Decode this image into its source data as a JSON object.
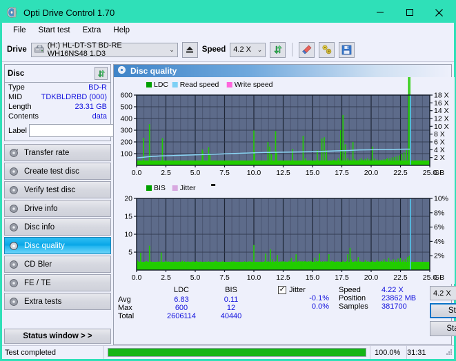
{
  "window": {
    "title": "Opti Drive Control 1.70",
    "app_icon": "disc-icon",
    "minimize": "–",
    "maximize": "▢",
    "close": "✕",
    "titlebar_color": "#2fe0b8"
  },
  "menubar": {
    "items": [
      {
        "label": "File"
      },
      {
        "label": "Start test"
      },
      {
        "label": "Extra"
      },
      {
        "label": "Help"
      }
    ]
  },
  "toolbar": {
    "drive_label": "Drive",
    "drive_value": "(H:)  HL-DT-ST BD-RE  WH16NS48 1.D3",
    "eject_icon": "eject-icon",
    "speed_label": "Speed",
    "speed_value": "4.2 X",
    "refresh_icon": "refresh-icon",
    "erase_icon": "eraser-icon",
    "tools_icon": "tools-icon",
    "save_icon": "save-floppy-icon",
    "dropdown_arrow": "⌄"
  },
  "disc_panel": {
    "title": "Disc",
    "refresh_icon": "refresh-icon",
    "rows": [
      {
        "key": "Type",
        "value": "BD-R"
      },
      {
        "key": "MID",
        "value": "TDKBLDRBD (000)"
      },
      {
        "key": "Length",
        "value": "23.31 GB"
      },
      {
        "key": "Contents",
        "value": "data"
      }
    ],
    "label_key": "Label",
    "label_value": "",
    "label_placeholder": "",
    "label_button_icon": "disc-icon"
  },
  "sidebar": {
    "items": [
      {
        "label": "Transfer rate",
        "icon": "disc-icon",
        "active": false
      },
      {
        "label": "Create test disc",
        "icon": "disc-icon",
        "active": false
      },
      {
        "label": "Verify test disc",
        "icon": "disc-icon",
        "active": false
      },
      {
        "label": "Drive info",
        "icon": "disc-icon",
        "active": false
      },
      {
        "label": "Disc info",
        "icon": "disc-icon",
        "active": false
      },
      {
        "label": "Disc quality",
        "icon": "disc-icon",
        "active": true
      },
      {
        "label": "CD Bler",
        "icon": "disc-icon",
        "active": false
      },
      {
        "label": "FE / TE",
        "icon": "disc-icon",
        "active": false
      },
      {
        "label": "Extra tests",
        "icon": "disc-icon",
        "active": false
      }
    ],
    "status_window_button": "Status window > >"
  },
  "content": {
    "header_title": "Disc quality",
    "header_icon": "disc-icon"
  },
  "stats": {
    "columns": [
      "LDC",
      "BIS"
    ],
    "rows": [
      {
        "label": "Avg",
        "ldc": "6.83",
        "bis": "0.11"
      },
      {
        "label": "Max",
        "ldc": "600",
        "bis": "12"
      },
      {
        "label": "Total",
        "ldc": "2606114",
        "bis": "40440"
      }
    ],
    "jitter_label": "Jitter",
    "jitter_checked": true,
    "jitter_values": [
      "-0.1%",
      "0.0%"
    ],
    "speed_label": "Speed",
    "speed_value": "4.22 X",
    "position_label": "Position",
    "position_value": "23862 MB",
    "samples_label": "Samples",
    "samples_value": "381700",
    "speed_select": "4.2 X",
    "start_full_button": "Start full",
    "start_part_button": "Start part"
  },
  "statusbar": {
    "message": "Test completed",
    "percent_text": "100.0%",
    "percent_value": 100,
    "elapsed": "31:31",
    "bar_color": "#16b516"
  },
  "chart_data": [
    {
      "type": "line",
      "id": "ldc-chart",
      "title": "",
      "xlabel": "GB",
      "ylabel": "",
      "xlim": [
        0,
        25
      ],
      "xticks": [
        "0.0",
        "2.5",
        "5.0",
        "7.5",
        "10.0",
        "12.5",
        "15.0",
        "17.5",
        "20.0",
        "22.5",
        "25.0"
      ],
      "x_unit_label": "GB",
      "ylim": [
        0,
        600
      ],
      "yticks": [
        "100",
        "200",
        "300",
        "400",
        "500",
        "600"
      ],
      "y2lim": [
        0,
        18
      ],
      "y2ticks": [
        "2 X",
        "4 X",
        "6 X",
        "8 X",
        "10 X",
        "12 X",
        "14 X",
        "16 X",
        "18 X"
      ],
      "grid": true,
      "plot_bg": "#5d6b8a",
      "legend_position": "top-left",
      "legend": [
        {
          "name": "LDC",
          "color": "#00a000"
        },
        {
          "name": "Read speed",
          "color": "#7ed0f5"
        },
        {
          "name": "Write speed",
          "color": "#ff66dd"
        }
      ],
      "series": [
        {
          "name": "LDC",
          "kind": "impulse",
          "color": "#22cc00",
          "x": [
            0.05,
            0.15,
            0.3,
            0.45,
            0.6,
            0.75,
            0.82,
            0.95,
            1.1,
            1.2,
            1.3,
            1.45,
            1.6,
            1.75,
            1.9,
            2.05,
            2.2,
            2.35,
            2.45,
            2.6,
            2.75,
            2.9,
            3.05,
            3.2,
            3.4,
            3.6,
            3.8,
            4.0,
            4.2,
            4.4,
            4.6,
            4.8,
            5.0,
            5.2,
            5.4,
            5.6,
            5.65,
            5.8,
            6.0,
            6.15,
            6.25,
            6.4,
            6.6,
            6.8,
            7.0,
            7.2,
            7.4,
            7.6,
            7.8,
            8.0,
            8.2,
            8.4,
            8.6,
            8.8,
            9.0,
            9.2,
            9.4,
            9.6,
            9.8,
            10.0,
            10.05,
            10.2,
            10.4,
            10.6,
            10.8,
            11.0,
            11.2,
            11.35,
            11.5,
            11.7,
            11.85,
            11.95,
            12.1,
            12.3,
            12.5,
            12.7,
            12.9,
            13.1,
            13.3,
            13.5,
            13.6,
            13.8,
            14.0,
            14.2,
            14.4,
            14.6,
            14.8,
            15.0,
            15.2,
            15.4,
            15.6,
            15.8,
            16.0,
            16.2,
            16.4,
            16.6,
            16.8,
            17.0,
            17.2,
            17.4,
            17.6,
            17.8,
            18.0,
            18.2,
            18.3,
            18.45,
            18.6,
            18.8,
            19.0,
            19.15,
            19.3,
            19.5,
            19.7,
            19.9,
            20.1,
            20.3,
            20.5,
            20.7,
            20.9,
            21.1,
            21.3,
            21.4,
            21.6,
            21.8,
            22.0,
            22.2,
            22.4,
            22.6,
            22.8,
            23.0,
            23.2,
            23.3
          ],
          "y": [
            30,
            25,
            20,
            22,
            235,
            28,
            22,
            24,
            352,
            30,
            26,
            22,
            25,
            20,
            24,
            22,
            232,
            30,
            24,
            20,
            22,
            26,
            18,
            20,
            22,
            18,
            20,
            22,
            20,
            24,
            20,
            22,
            20,
            24,
            22,
            135,
            120,
            24,
            22,
            155,
            90,
            24,
            20,
            22,
            18,
            22,
            20,
            18,
            22,
            20,
            24,
            20,
            22,
            18,
            20,
            22,
            24,
            20,
            22,
            298,
            120,
            25,
            22,
            26,
            24,
            22,
            200,
            160,
            95,
            40,
            292,
            120,
            35,
            28,
            24,
            22,
            26,
            30,
            140,
            40,
            28,
            26,
            30,
            252,
            60,
            34,
            30,
            28,
            36,
            130,
            32,
            228,
            240,
            130,
            40,
            35,
            48,
            42,
            60,
            300,
            430,
            180,
            60,
            48,
            42,
            200,
            55,
            45,
            50,
            60,
            48,
            55,
            60,
            52,
            160,
            58,
            50,
            46,
            48,
            52,
            55,
            60,
            62,
            68,
            72,
            78,
            85,
            95,
            110,
            130
          ]
        },
        {
          "name": "Read speed",
          "kind": "line",
          "color": "#8cd8f7",
          "x": [
            0.0,
            1.0,
            2.0,
            3.0,
            4.0,
            5.0,
            6.0,
            7.0,
            8.0,
            9.0,
            10.0,
            11.0,
            12.0,
            13.0,
            14.0,
            15.0,
            16.0,
            17.0,
            18.0,
            19.0,
            20.0,
            21.0,
            22.0,
            23.0,
            23.3
          ],
          "y_speed": [
            1.9,
            2.2,
            2.4,
            2.5,
            2.6,
            2.7,
            2.8,
            2.9,
            3.0,
            3.1,
            3.2,
            3.3,
            3.35,
            3.4,
            3.45,
            3.5,
            3.6,
            3.7,
            3.8,
            3.95,
            4.0,
            4.05,
            4.1,
            4.15,
            4.15
          ]
        },
        {
          "name": "Write speed",
          "kind": "none",
          "color": "#ff66dd",
          "x": [],
          "y": []
        }
      ],
      "cursor_line": {
        "x": 23.35,
        "color": "#53c7f0"
      }
    },
    {
      "type": "line",
      "id": "bis-jitter-chart",
      "title": "",
      "xlabel": "GB",
      "xlim": [
        0,
        25
      ],
      "xticks": [
        "0.0",
        "2.5",
        "5.0",
        "7.5",
        "10.0",
        "12.5",
        "15.0",
        "17.5",
        "20.0",
        "22.5",
        "25.0"
      ],
      "x_unit_label": "GB",
      "ylim": [
        0,
        20
      ],
      "yticks": [
        "5",
        "10",
        "15",
        "20"
      ],
      "y2lim": [
        0,
        10
      ],
      "y2ticks": [
        "2%",
        "4%",
        "6%",
        "8%",
        "10%"
      ],
      "grid": true,
      "plot_bg": "#5d6b8a",
      "legend_position": "top-left",
      "legend": [
        {
          "name": "BIS",
          "color": "#00a000"
        },
        {
          "name": "Jitter",
          "color": "#d8a8e0"
        }
      ],
      "series": [
        {
          "name": "BIS",
          "kind": "impulse",
          "color": "#22cc00",
          "x": [
            0.05,
            0.2,
            0.35,
            0.5,
            0.65,
            0.8,
            0.95,
            1.1,
            1.2,
            1.35,
            1.5,
            1.65,
            1.8,
            1.95,
            2.1,
            2.25,
            2.4,
            2.5,
            2.65,
            2.8,
            2.95,
            3.1,
            3.3,
            3.5,
            3.7,
            3.9,
            4.1,
            4.3,
            4.5,
            4.7,
            4.9,
            5.1,
            5.3,
            5.5,
            5.7,
            5.9,
            6.1,
            6.3,
            6.5,
            6.7,
            6.9,
            7.1,
            7.3,
            7.5,
            7.7,
            7.9,
            8.1,
            8.3,
            8.5,
            8.7,
            8.9,
            9.1,
            9.3,
            9.5,
            9.7,
            9.9,
            10.0,
            10.2,
            10.4,
            10.6,
            10.8,
            11.0,
            11.2,
            11.4,
            11.6,
            11.8,
            12.0,
            12.2,
            12.4,
            12.6,
            12.8,
            13.0,
            13.2,
            13.4,
            13.6,
            13.8,
            14.0,
            14.2,
            14.4,
            14.6,
            14.8,
            15.0,
            15.2,
            15.4,
            15.6,
            15.8,
            16.0,
            16.2,
            16.4,
            16.6,
            16.8,
            17.0,
            17.2,
            17.4,
            17.6,
            17.8,
            18.0,
            18.2,
            18.3,
            18.5,
            18.7,
            18.9,
            19.1,
            19.3,
            19.5,
            19.7,
            19.9,
            20.1,
            20.3,
            20.5,
            20.7,
            20.9,
            21.1,
            21.3,
            21.5,
            21.7,
            21.9,
            22.1,
            22.3,
            22.5,
            22.7,
            22.9,
            23.1,
            23.25
          ],
          "y": [
            2.8,
            1.6,
            4.8,
            2.2,
            1.8,
            2.5,
            1.9,
            6.8,
            2.4,
            1.8,
            2.2,
            1.6,
            2.0,
            2.4,
            4.9,
            2.1,
            1.8,
            2.6,
            2.0,
            1.7,
            2.2,
            1.9,
            2.4,
            2.0,
            1.8,
            2.6,
            2.1,
            1.9,
            2.3,
            2.0,
            1.8,
            2.5,
            2.2,
            1.9,
            2.1,
            2.4,
            1.8,
            2.2,
            2.0,
            2.6,
            1.9,
            2.1,
            2.3,
            1.8,
            2.2,
            2.0,
            2.4,
            1.9,
            2.1,
            2.3,
            1.8,
            2.0,
            2.2,
            1.9,
            2.4,
            2.1,
            7.0,
            2.0,
            2.3,
            1.9,
            2.2,
            4.6,
            2.5,
            5.8,
            3.0,
            2.2,
            4.2,
            2.4,
            1.9,
            2.2,
            2.0,
            2.6,
            3.4,
            2.2,
            4.4,
            2.6,
            2.0,
            2.4,
            1.9,
            2.2,
            2.6,
            2.1,
            3.4,
            2.4,
            4.6,
            2.2,
            2.0,
            2.4,
            4.4,
            2.6,
            2.2,
            1.9,
            2.4,
            2.1,
            2.6,
            2.2,
            4.4,
            6.2,
            3.0,
            2.2,
            2.6,
            3.6,
            2.4,
            2.2,
            2.8,
            2.4,
            2.0,
            2.6,
            2.2,
            2.8,
            2.4,
            2.6,
            3.0,
            2.4,
            3.4,
            2.6,
            3.0,
            2.8,
            3.2,
            3.4,
            2.8,
            3.0,
            3.6,
            4.0
          ]
        },
        {
          "name": "Jitter",
          "kind": "none",
          "color": "#d8a8e0",
          "x": [],
          "y": []
        }
      ],
      "cursor_line": {
        "x": 23.35,
        "color": "#53c7f0"
      }
    }
  ]
}
